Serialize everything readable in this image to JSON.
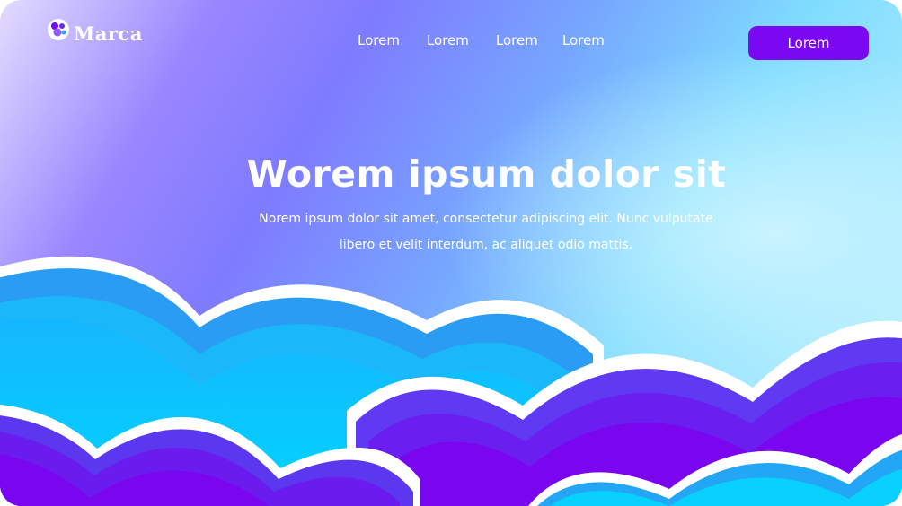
{
  "brand": {
    "name": "Marca",
    "icon": "bubbles-logo-icon"
  },
  "nav": {
    "items": [
      "Lorem",
      "Lorem",
      "Lorem",
      "Lorem"
    ]
  },
  "cta": {
    "label": "Lorem"
  },
  "hero": {
    "title": "Worem ipsum dolor sit",
    "subtitle": "Norem ipsum dolor sit amet, consectetur adipiscing elit. Nunc vulputate libero et velit interdum, ac aliquet odio mattis."
  },
  "colors": {
    "accent": "#7a09f2",
    "cloud_cyan": "#08cfff",
    "cloud_blue": "#2ea2f5",
    "cloud_purple": "#6f10ee",
    "cloud_violet": "#5a34f0",
    "outline": "#ffffff"
  }
}
